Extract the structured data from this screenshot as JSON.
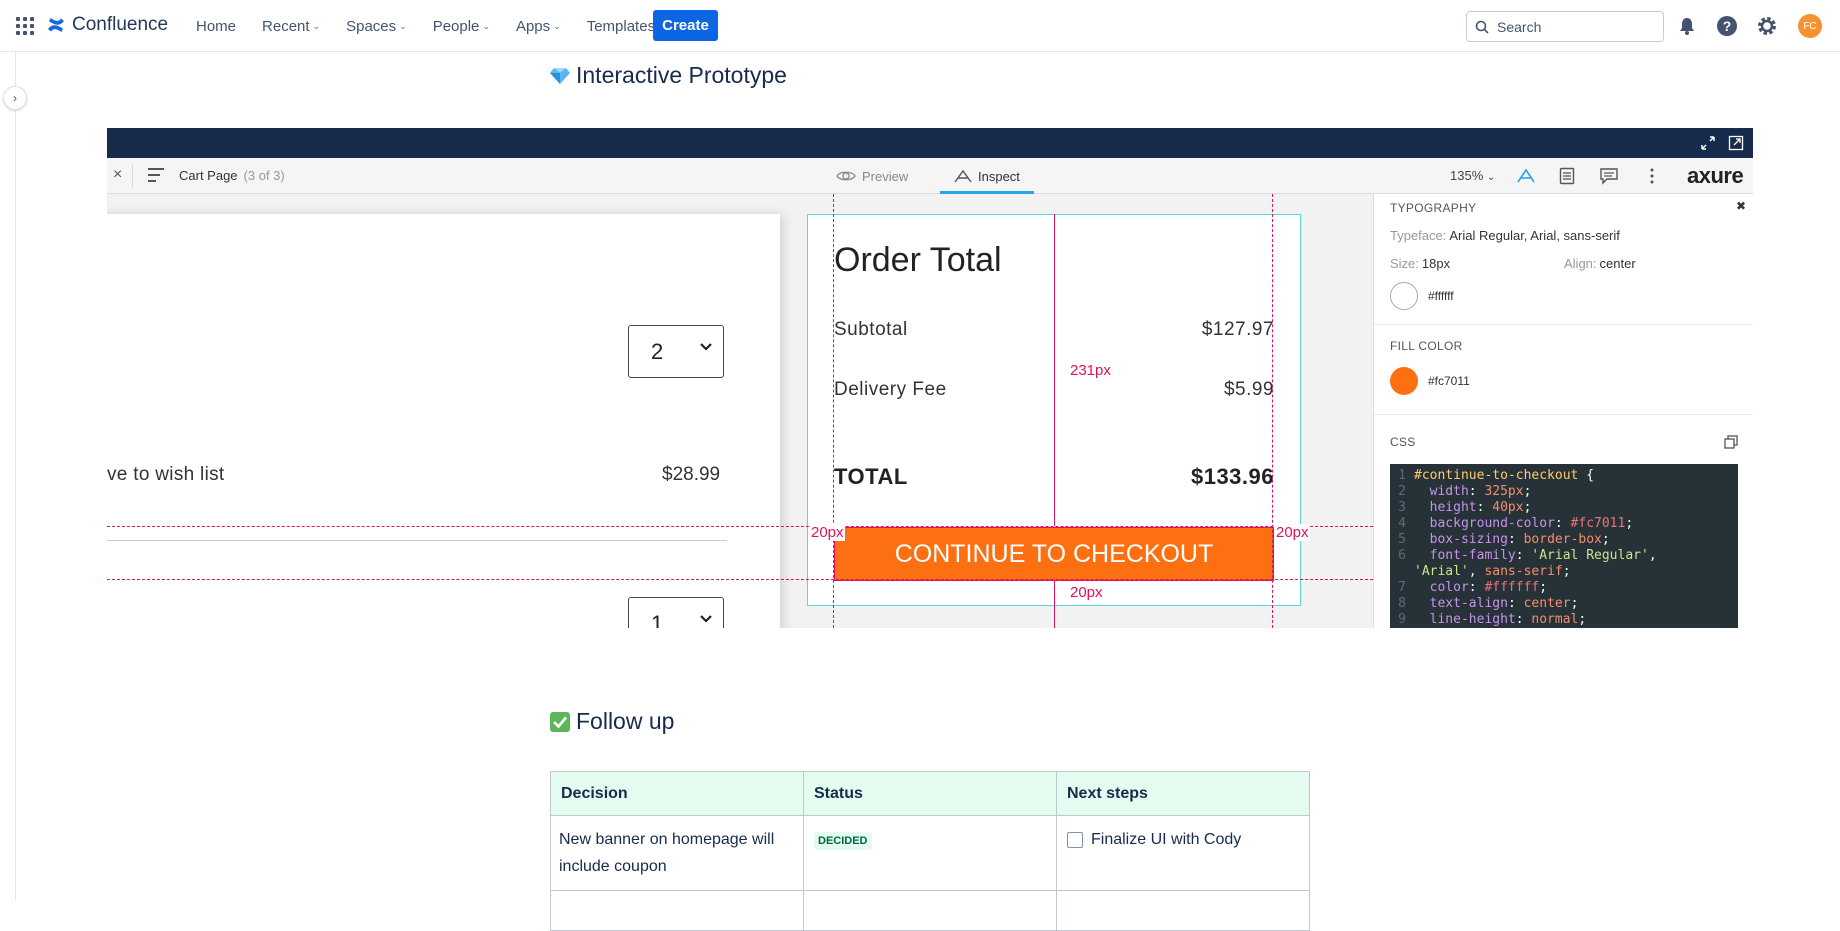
{
  "topnav": {
    "brand": "Confluence",
    "items": [
      {
        "label": "Home",
        "has_dropdown": false
      },
      {
        "label": "Recent",
        "has_dropdown": true
      },
      {
        "label": "Spaces",
        "has_dropdown": true
      },
      {
        "label": "People",
        "has_dropdown": true
      },
      {
        "label": "Apps",
        "has_dropdown": true
      },
      {
        "label": "Templates",
        "has_dropdown": false
      }
    ],
    "create_label": "Create",
    "search_placeholder": "Search",
    "avatar_initials": "FC"
  },
  "page": {
    "section1_title": "Interactive Prototype",
    "section2_title": "Follow up"
  },
  "prototype": {
    "toolbar": {
      "close_glyph": "×",
      "page_name": "Cart Page",
      "page_count": "(3 of 3)",
      "tab_preview": "Preview",
      "tab_inspect": "Inspect",
      "active_tab": "Inspect",
      "zoom": "135%",
      "brand": "axure"
    },
    "cart": {
      "qty1": "2",
      "wish_text": "ve to wish list",
      "wish_price": "$28.99",
      "qty2": "1"
    },
    "order": {
      "title": "Order Total",
      "subtotal_label": "Subtotal",
      "subtotal_value": "$127.97",
      "delivery_label": "Delivery Fee",
      "delivery_value": "$5.99",
      "total_label": "TOTAL",
      "total_value": "$133.96",
      "button_label": "CONTINUE TO CHECKOUT"
    },
    "measurements": {
      "top_gap": "231px",
      "left_gap": "20px",
      "right_gap": "20px",
      "bottom_gap": "20px"
    },
    "inspect": {
      "typography_title": "TYPOGRAPHY",
      "typeface_label": "Typeface:",
      "typeface_value": "Arial Regular, Arial, sans-serif",
      "size_label": "Size:",
      "size_value": "18px",
      "align_label": "Align:",
      "align_value": "center",
      "text_color": "#ffffff",
      "fill_title": "FILL COLOR",
      "fill_color": "#fc7011",
      "css_title": "CSS"
    }
  },
  "css_code": [
    {
      "n": "1",
      "parts": [
        [
          "sel",
          "#continue-to-checkout"
        ],
        [
          "plain",
          " {"
        ]
      ]
    },
    {
      "n": "2",
      "parts": [
        [
          "plain",
          "  "
        ],
        [
          "prop",
          "width"
        ],
        [
          "plain",
          ": "
        ],
        [
          "num",
          "325px"
        ],
        [
          "plain",
          ";"
        ]
      ]
    },
    {
      "n": "3",
      "parts": [
        [
          "plain",
          "  "
        ],
        [
          "prop",
          "height"
        ],
        [
          "plain",
          ": "
        ],
        [
          "num",
          "40px"
        ],
        [
          "plain",
          ";"
        ]
      ]
    },
    {
      "n": "4",
      "parts": [
        [
          "plain",
          "  "
        ],
        [
          "prop",
          "background-color"
        ],
        [
          "plain",
          ": "
        ],
        [
          "val",
          "#fc7011"
        ],
        [
          "plain",
          ";"
        ]
      ]
    },
    {
      "n": "5",
      "parts": [
        [
          "plain",
          "  "
        ],
        [
          "prop",
          "box-sizing"
        ],
        [
          "plain",
          ": "
        ],
        [
          "num",
          "border-box"
        ],
        [
          "plain",
          ";"
        ]
      ]
    },
    {
      "n": "6",
      "parts": [
        [
          "plain",
          "  "
        ],
        [
          "prop",
          "font-family"
        ],
        [
          "plain",
          ": "
        ],
        [
          "str",
          "'Arial Regular'"
        ],
        [
          "plain",
          ","
        ]
      ]
    },
    {
      "n": "",
      "parts": [
        [
          "str",
          "'Arial'"
        ],
        [
          "plain",
          ", "
        ],
        [
          "num",
          "sans-serif"
        ],
        [
          "plain",
          ";"
        ]
      ]
    },
    {
      "n": "7",
      "parts": [
        [
          "plain",
          "  "
        ],
        [
          "prop",
          "color"
        ],
        [
          "plain",
          ": "
        ],
        [
          "val",
          "#ffffff"
        ],
        [
          "plain",
          ";"
        ]
      ]
    },
    {
      "n": "8",
      "parts": [
        [
          "plain",
          "  "
        ],
        [
          "prop",
          "text-align"
        ],
        [
          "plain",
          ": "
        ],
        [
          "num",
          "center"
        ],
        [
          "plain",
          ";"
        ]
      ]
    },
    {
      "n": "9",
      "parts": [
        [
          "plain",
          "  "
        ],
        [
          "prop",
          "line-height"
        ],
        [
          "plain",
          ": "
        ],
        [
          "num",
          "normal"
        ],
        [
          "plain",
          ";"
        ]
      ]
    }
  ],
  "followup_table": {
    "headers": [
      "Decision",
      "Status",
      "Next steps"
    ],
    "rows": [
      {
        "decision": "New banner on homepage will include coupon",
        "status": "DECIDED",
        "next_step": "Finalize UI with Cody"
      }
    ]
  },
  "colors": {
    "brand_blue": "#0c66e4",
    "axure_navy": "#172b4d",
    "checkout_orange": "#fc7011",
    "redline_pink": "#e0115f",
    "table_header_green": "#e3fcef"
  }
}
